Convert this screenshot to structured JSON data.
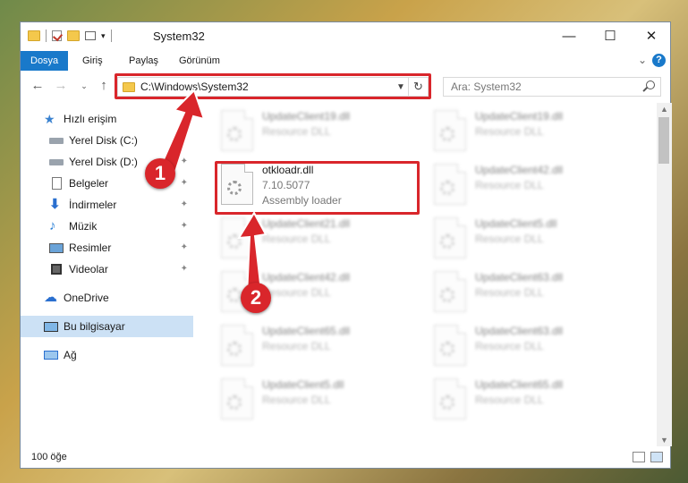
{
  "titlebar": {
    "title": "System32",
    "minimize": "—",
    "maximize": "☐",
    "close": "✕"
  },
  "ribbon": {
    "tabs": [
      "Dosya",
      "Giriş",
      "Paylaş",
      "Görünüm"
    ],
    "help": "?"
  },
  "address": {
    "path": "C:\\Windows\\System32",
    "search_placeholder": "Ara: System32"
  },
  "nav": {
    "items": [
      {
        "label": "Hızlı erişim",
        "icon": "star-icon"
      },
      {
        "label": "Yerel Disk (C:)",
        "icon": "drive-icon"
      },
      {
        "label": "Yerel Disk (D:)",
        "icon": "drive-icon"
      },
      {
        "label": "Belgeler",
        "icon": "documents-icon"
      },
      {
        "label": "İndirmeler",
        "icon": "download-icon"
      },
      {
        "label": "Müzik",
        "icon": "music-icon"
      },
      {
        "label": "Resimler",
        "icon": "pictures-icon"
      },
      {
        "label": "Videolar",
        "icon": "video-icon"
      },
      {
        "label": "OneDrive",
        "icon": "cloud-icon"
      },
      {
        "label": "Bu bilgisayar",
        "icon": "computer-icon"
      },
      {
        "label": "Ağ",
        "icon": "network-icon"
      }
    ]
  },
  "files": [
    {
      "name": "UpdateClient19.dll",
      "type": "Resource DLL"
    },
    {
      "name": "UpdateClient19.dll",
      "type": "Resource DLL"
    },
    {
      "name": "otkloadr.dll",
      "version": "7.10.5077",
      "type": "Assembly loader"
    },
    {
      "name": "UpdateClient42.dll",
      "type": "Resource DLL"
    },
    {
      "name": "UpdateClient21.dll",
      "type": "Resource DLL"
    },
    {
      "name": "UpdateClient5.dll",
      "type": "Resource DLL"
    },
    {
      "name": "UpdateClient42.dll",
      "type": "Resource DLL"
    },
    {
      "name": "UpdateClient63.dll",
      "type": "Resource DLL"
    },
    {
      "name": "UpdateClient65.dll",
      "type": "Resource DLL"
    },
    {
      "name": "UpdateClient63.dll",
      "type": "Resource DLL"
    },
    {
      "name": "UpdateClient5.dll",
      "type": "Resource DLL"
    },
    {
      "name": "UpdateClient65.dll",
      "type": "Resource DLL"
    }
  ],
  "status": {
    "count": "100 öğe"
  },
  "callouts": [
    "1",
    "2"
  ],
  "colors": {
    "accent": "#1979ca",
    "highlight": "#d9262b",
    "selected": "#cce1f5"
  }
}
